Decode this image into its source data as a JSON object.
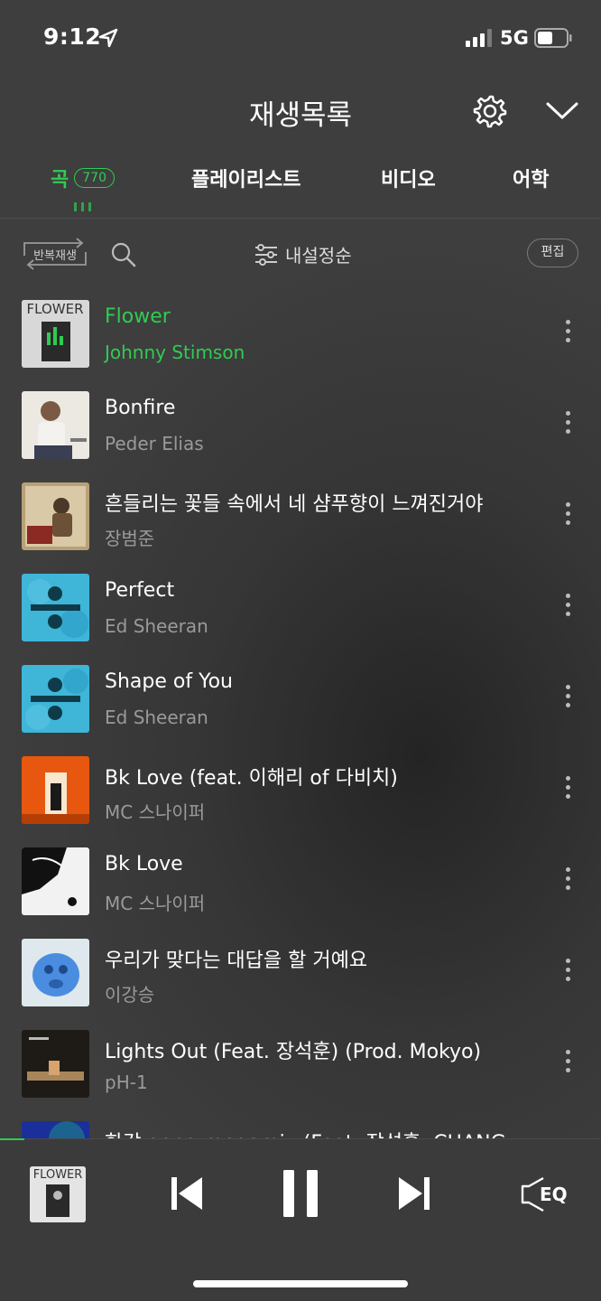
{
  "status": {
    "time": "9:12",
    "network": "5G"
  },
  "header": {
    "title": "재생목록"
  },
  "tabs": {
    "song": {
      "label": "곡",
      "count": "770"
    },
    "playlist": "플레이리스트",
    "video": "비디오",
    "language": "어학"
  },
  "toolbar": {
    "repeat_label": "반복재생",
    "sort_label": "내설정순",
    "edit_label": "편집"
  },
  "tracks": [
    {
      "title": "Flower",
      "artist": "Johnny Stimson",
      "active": true,
      "cover_text": "FLOWER"
    },
    {
      "title": "Bonfire",
      "artist": "Peder Elias"
    },
    {
      "title": "흔들리는 꽃들 속에서 네 샴푸향이 느껴진거야",
      "artist": "장범준"
    },
    {
      "title": "Perfect",
      "artist": "Ed Sheeran"
    },
    {
      "title": "Shape of You",
      "artist": "Ed Sheeran"
    },
    {
      "title": "Bk Love (feat. 이해리 of 다비치)",
      "artist": "MC 스나이퍼"
    },
    {
      "title": "Bk Love",
      "artist": "MC 스나이퍼"
    },
    {
      "title": "우리가 맞다는 대답을 할 거예요",
      "artist": "이강승"
    },
    {
      "title": "Lights Out (Feat. 장석훈) (Prod. Mokyo)",
      "artist": "pH-1"
    },
    {
      "title": "한강 gang megamix (Feat. 장석훈, CHANG",
      "artist": ""
    }
  ],
  "player": {
    "mini_cover_text": "FLOWER",
    "eq_label": "EQ",
    "progress": 0.04
  },
  "colors": {
    "accent": "#2fcc52",
    "background": "#3a3a3a",
    "muted_text": "#9a9a9a"
  }
}
